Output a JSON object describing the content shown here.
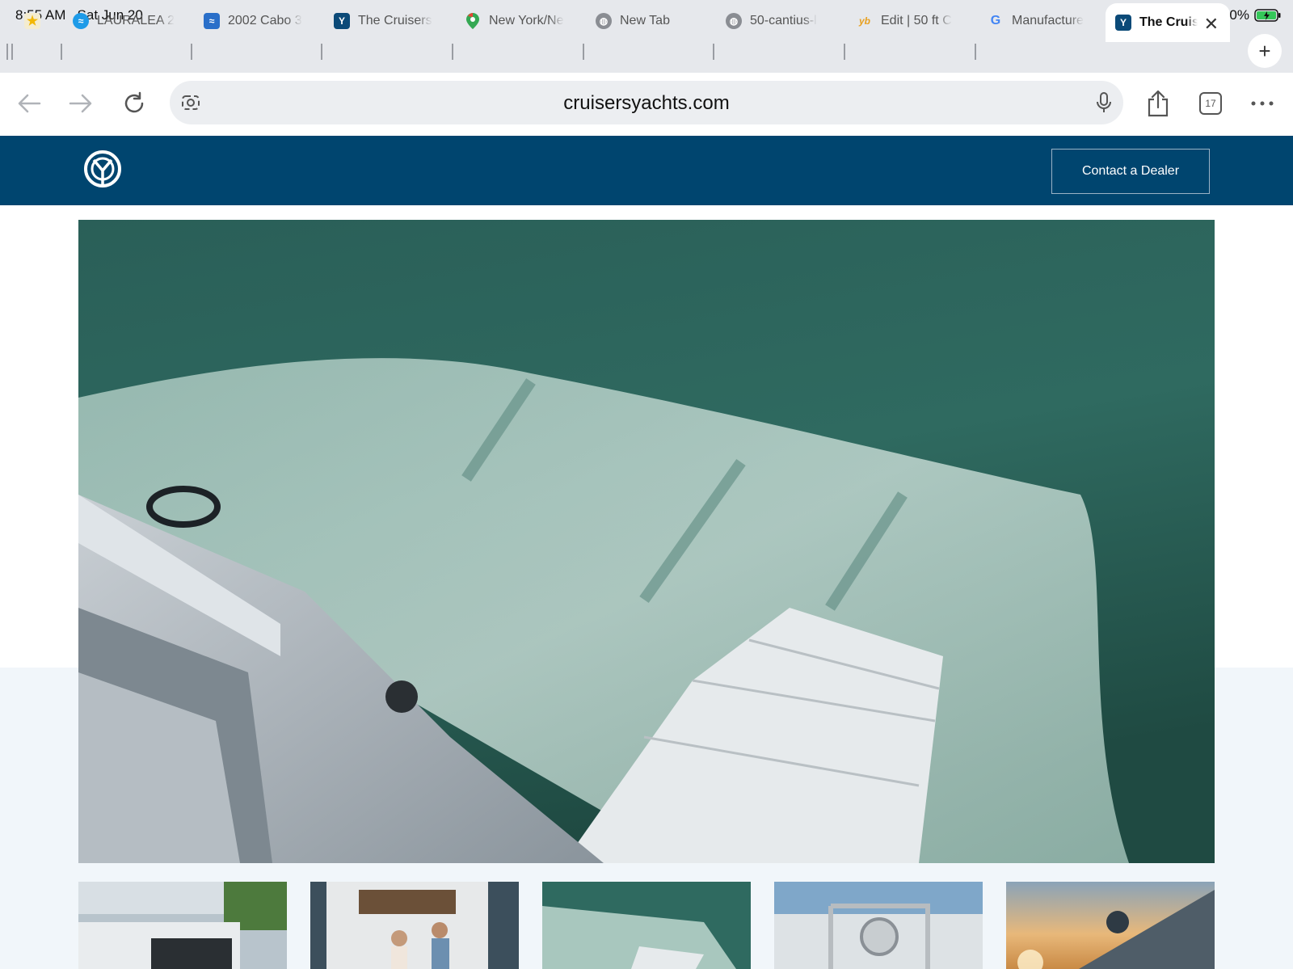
{
  "status_bar": {
    "time": "8:55 AM",
    "date": "Sat Jun 20",
    "battery": "100%"
  },
  "tabs": [
    {
      "title": "",
      "icon": "star-bookmark-icon",
      "color": "#f2b705"
    },
    {
      "title": "LAURALEA 2",
      "icon": "globe-blue-icon",
      "color": "#1e9be8"
    },
    {
      "title": "2002 Cabo 3",
      "icon": "site-favicon",
      "color": "#2a6fc9"
    },
    {
      "title": "The Cruisers",
      "icon": "cruisers-logo-icon",
      "color": "#0b4a78"
    },
    {
      "title": "New York/Ne",
      "icon": "maps-pin-icon",
      "color": "#34a853"
    },
    {
      "title": "New Tab",
      "icon": "globe-icon",
      "color": "#8a8d93"
    },
    {
      "title": "50-cantius-l",
      "icon": "globe-icon",
      "color": "#8a8d93"
    },
    {
      "title": "Edit | 50 ft C",
      "icon": "yb-icon",
      "color": "#e8a020"
    },
    {
      "title": "Manufacture",
      "icon": "google-icon",
      "color": "#4285f4"
    },
    {
      "title": "The Cruis",
      "icon": "cruisers-logo-icon",
      "color": "#0b4a78",
      "active": true
    }
  ],
  "toolbar": {
    "url": "cruisersyachts.com",
    "tab_count": "17"
  },
  "site": {
    "contact_button": "Contact a Dealer",
    "brand_color": "#00456f"
  },
  "hero": {
    "description_icon": "boat-swim-platform-photo"
  },
  "thumbnails": [
    "boat-stern-island-photo",
    "couple-on-deck-photo",
    "swim-platform-wake-photo",
    "bow-rail-logo-photo",
    "sunset-hull-photo"
  ]
}
